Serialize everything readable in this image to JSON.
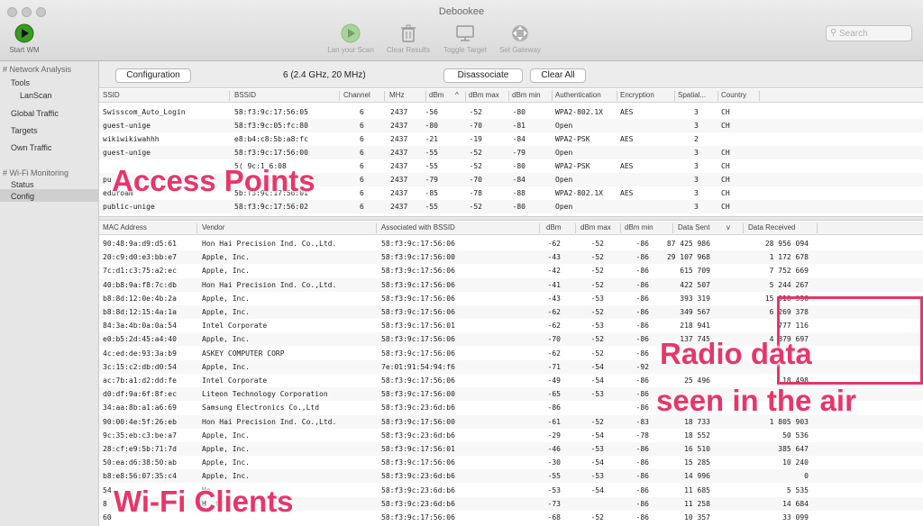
{
  "window": {
    "title": "Debookee"
  },
  "toolbar": {
    "start": "Start WM",
    "lan": "Lan your Scan",
    "clear": "Clear Results",
    "toggle": "Toggle Target",
    "gateway": "Set Gateway",
    "search_placeholder": "Search"
  },
  "sidebar": {
    "network_analysis": "# Network Analysis",
    "tools": "Tools",
    "lanscan": "LanScan",
    "global_traffic": "Global Traffic",
    "targets": "Targets",
    "own_traffic": "Own Traffic",
    "wifi_monitoring": "# Wi-Fi Monitoring",
    "status": "Status",
    "config": "Config"
  },
  "controls": {
    "configuration": "Configuration",
    "channel_info": "6 (2.4 GHz, 20 MHz)",
    "disassociate": "Disassociate",
    "clear_all": "Clear All"
  },
  "ap_table": {
    "headers": [
      "SSID",
      "BSSID",
      "Channel",
      "MHz",
      "dBm",
      "dBm max",
      "dBm min",
      "Authentication",
      "Encryption",
      "Spatial...",
      "Country"
    ],
    "sort_arrow": "^",
    "rows": [
      [
        "Swisscom_Auto_Login",
        "58:f3:9c:17:56:05",
        "6",
        "2437",
        "-56",
        "-52",
        "-80",
        "WPA2-802.1X",
        "AES",
        "3",
        "CH"
      ],
      [
        "guest-unige",
        "58:f3:9c:05:fc:80",
        "6",
        "2437",
        "-80",
        "-70",
        "-81",
        "Open",
        "",
        "3",
        "CH"
      ],
      [
        "wikiwikiwahhh",
        "e8:b4:c8:5b:a8:fc",
        "6",
        "2437",
        "-21",
        "-19",
        "-84",
        "WPA2-PSK",
        "AES",
        "2",
        ""
      ],
      [
        "guest-unige",
        "58:f3:9c:17:56:00",
        "6",
        "2437",
        "-55",
        "-52",
        "-79",
        "Open",
        "",
        "3",
        "CH"
      ],
      [
        "",
        "5(  9c:1  6:08",
        "6",
        "2437",
        "-55",
        "-52",
        "-80",
        "WPA2-PSK",
        "AES",
        "3",
        "CH"
      ],
      [
        "pu",
        "",
        "6",
        "2437",
        "-79",
        "-70",
        "-84",
        "Open",
        "",
        "3",
        "CH"
      ],
      [
        "eduroam",
        "5b:f3:9c:17:56:01",
        "6",
        "2437",
        "-85",
        "-78",
        "-88",
        "WPA2-802.1X",
        "AES",
        "3",
        "CH"
      ],
      [
        "public-unige",
        "58:f3:9c:17:56:02",
        "6",
        "2437",
        "-55",
        "-52",
        "-80",
        "Open",
        "",
        "3",
        "CH"
      ]
    ]
  },
  "client_table": {
    "headers": [
      "MAC Address",
      "Vendor",
      "Associated with BSSID",
      "dBm",
      "dBm max",
      "dBm min",
      "Data Sent",
      "Data Received"
    ],
    "sort_arrow": "v",
    "rows": [
      [
        "90:48:9a:d9:d5:61",
        "Hon Hai Precision Ind. Co.,Ltd.",
        "58:f3:9c:17:56:06",
        "-62",
        "-52",
        "-86",
        "87 425 986",
        "28 956 094"
      ],
      [
        "20:c9:d0:e3:bb:e7",
        "Apple, Inc.",
        "58:f3:9c:17:56:00",
        "-43",
        "-52",
        "-86",
        "29 107 968",
        "1 172 678"
      ],
      [
        "7c:d1:c3:75:a2:ec",
        "Apple, Inc.",
        "58:f3:9c:17:56:06",
        "-42",
        "-52",
        "-86",
        "615 709",
        "7 752 669"
      ],
      [
        "40:b8:9a:f8:7c:db",
        "Hon Hai Precision Ind. Co.,Ltd.",
        "58:f3:9c:17:56:06",
        "-41",
        "-52",
        "-86",
        "422 507",
        "5 244 267"
      ],
      [
        "b8:8d:12:0e:4b:2a",
        "Apple, Inc.",
        "58:f3:9c:17:56:06",
        "-43",
        "-53",
        "-86",
        "393 319",
        "15 910 996"
      ],
      [
        "b8:8d:12:15:4a:1a",
        "Apple, Inc.",
        "58:f3:9c:17:56:06",
        "-62",
        "-52",
        "-86",
        "349 567",
        "6 269 378"
      ],
      [
        "84:3a:4b:0a:0a:54",
        "Intel Corporate",
        "58:f3:9c:17:56:01",
        "-62",
        "-53",
        "-86",
        "218 941",
        "777 116"
      ],
      [
        "e0:b5:2d:45:a4:40",
        "Apple, Inc.",
        "58:f3:9c:17:56:06",
        "-70",
        "-52",
        "-86",
        "137 745",
        "4 379 697"
      ],
      [
        "4c:ed:de:93:3a:b9",
        "ASKEY COMPUTER CORP",
        "58:f3:9c:17:56:06",
        "-62",
        "-52",
        "-86",
        "",
        ""
      ],
      [
        "3c:15:c2:db:d0:54",
        "Apple, Inc.",
        "7e:01:91:54:94:f6",
        "-71",
        "-54",
        "-92",
        "",
        ""
      ],
      [
        "ac:7b:a1:d2:dd:fe",
        "Intel Corporate",
        "58:f3:9c:17:56:06",
        "-49",
        "-54",
        "-86",
        "25 496",
        "18 498"
      ],
      [
        "d0:df:9a:6f:8f:ec",
        "Liteon Technology Corporation",
        "58:f3:9c:17:56:00",
        "-65",
        "-53",
        "-86",
        "",
        ""
      ],
      [
        "34:aa:8b:a1:a6:69",
        "Samsung Electronics Co.,Ltd",
        "58:f3:9c:23:6d:b6",
        "-86",
        "",
        "-86",
        "",
        ""
      ],
      [
        "90:00:4e:5f:26:eb",
        "Hon Hai Precision Ind. Co.,Ltd.",
        "58:f3:9c:17:56:00",
        "-61",
        "-52",
        "-83",
        "18 733",
        "1 805 903"
      ],
      [
        "9c:35:eb:c3:be:a7",
        "Apple, Inc.",
        "58:f3:9c:23:6d:b6",
        "-29",
        "-54",
        "-78",
        "18 552",
        "50 536"
      ],
      [
        "28:cf:e9:5b:71:7d",
        "Apple, Inc.",
        "58:f3:9c:17:56:01",
        "-46",
        "-53",
        "-86",
        "16 510",
        "385 647"
      ],
      [
        "50:ea:d6:38:50:ab",
        "Apple, Inc.",
        "58:f3:9c:17:56:06",
        "-30",
        "-54",
        "-86",
        "15 285",
        "10 240"
      ],
      [
        "b8:e8:56:07:35:c4",
        "Apple, Inc.",
        "58:f3:9c:23:6d:b6",
        "-55",
        "-53",
        "-86",
        "14 996",
        "0"
      ],
      [
        "54",
        "Ho",
        "58:f3:9c:23:6d:b6",
        "-53",
        "-54",
        "-86",
        "11 685",
        "5 535"
      ],
      [
        "8",
        "H  .td.",
        "58:f3:9c:23:6d:b6",
        "-73",
        "",
        "-86",
        "11 258",
        "14 684"
      ],
      [
        "60",
        "",
        "58:f3:9c:17:56:06",
        "-68",
        "-52",
        "-86",
        "10 357",
        "33 099"
      ]
    ]
  },
  "annotations": {
    "access_points": "Access Points",
    "radio_data_1": "Radio data",
    "radio_data_2": "seen in the air",
    "wifi_clients": "Wi-Fi Clients"
  },
  "colors": {
    "annotation": "#e8356a",
    "start_button": "#3a9a22"
  }
}
